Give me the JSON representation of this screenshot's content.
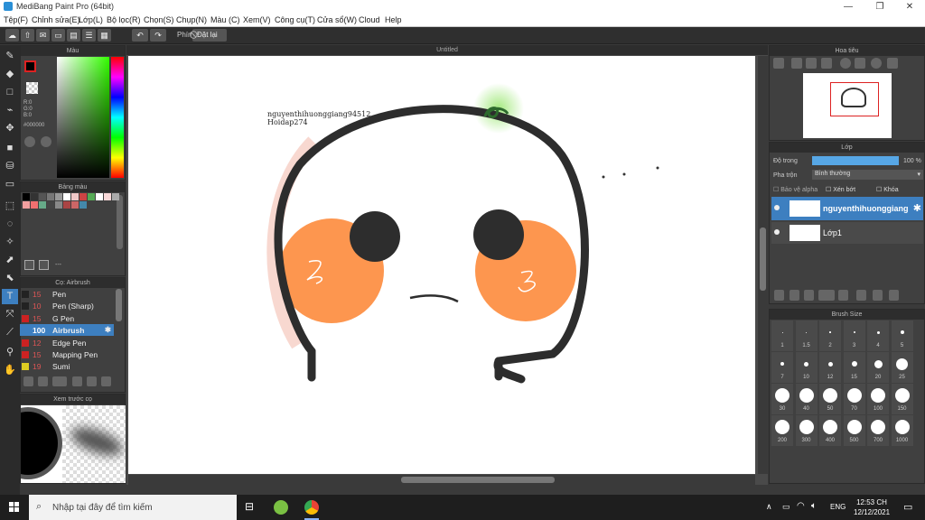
{
  "app_title": "MediBang Paint Pro (64bit)",
  "window_buttons": [
    "—",
    "❐",
    "✕"
  ],
  "menu": [
    "Tệp(F)",
    "Chỉnh sửa(E)",
    "Lớp(L)",
    "Bộ lọc(R)",
    "Chọn(S)",
    "Chụp(N)",
    "Màu (C)",
    "Xem(V)",
    "Công cụ(T)",
    "Cửa sổ(W)",
    "Cloud",
    "Help"
  ],
  "toolbar": {
    "keys_label": "Phím",
    "reset_label": "Đặt lại"
  },
  "color_panel": {
    "title": "Màu",
    "r": "R:0",
    "g": "G:0",
    "b": "B:0",
    "hex": "#000000"
  },
  "palette_panel": {
    "title": "Bảng màu",
    "footer": "---"
  },
  "brush_panel": {
    "title": "Cọ: Airbrush",
    "items": [
      {
        "size": "15",
        "name": "Pen",
        "color": "#222222"
      },
      {
        "size": "10",
        "name": "Pen (Sharp)",
        "color": "#222222"
      },
      {
        "size": "15",
        "name": "G Pen",
        "color": "#cc2222"
      },
      {
        "size": "100",
        "name": "Airbrush",
        "color": "#3d7fc0"
      },
      {
        "size": "12",
        "name": "Edge Pen",
        "color": "#cc2222"
      },
      {
        "size": "15",
        "name": "Mapping Pen",
        "color": "#cc2222"
      },
      {
        "size": "19",
        "name": "Sumi",
        "color": "#ddcc22"
      }
    ]
  },
  "brush_preview": {
    "title": "Xem trước cọ"
  },
  "canvas": {
    "tab": "Untitled",
    "watermark_1": "nguyenthihuonggiang94512",
    "watermark_2": "Hoidap274"
  },
  "navigator": {
    "title": "Hoa tiêu"
  },
  "layer_panel": {
    "title": "Lớp",
    "opacity_label": "Độ trong",
    "opacity_value": "100 %",
    "blend_label": "Pha trộn",
    "blend_value": "Bình thường",
    "protect_alpha": "Bảo vệ alpha",
    "clipping": "Xén bớt",
    "lock": "Khóa",
    "layers": [
      {
        "name": "nguyenthihuonggiang"
      },
      {
        "name": "Lớp1"
      }
    ]
  },
  "brush_size": {
    "title": "Brush Size",
    "sizes": [
      "1",
      "1.5",
      "2",
      "3",
      "4",
      "5",
      "7",
      "10",
      "12",
      "15",
      "20",
      "25",
      "30",
      "40",
      "50",
      "70",
      "100",
      "150",
      "200",
      "300",
      "400",
      "500",
      "700",
      "1000"
    ]
  },
  "taskbar": {
    "search_placeholder": "Nhập tại đây để tìm kiếm",
    "lang": "ENG",
    "time": "12:53 CH",
    "date": "12/12/2021"
  }
}
